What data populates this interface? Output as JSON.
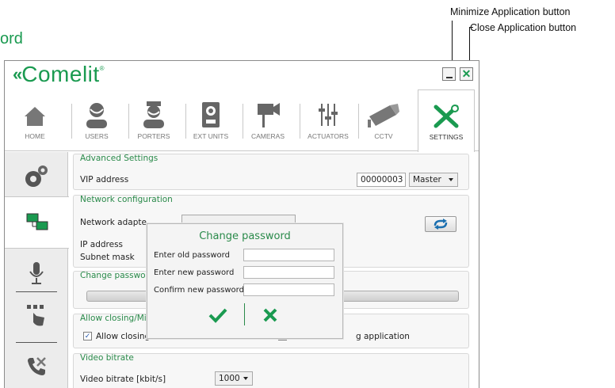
{
  "section_heading": "ord",
  "callouts": {
    "minimize": "Minimize Application button",
    "close": "Close Application button"
  },
  "app": {
    "brand": "Comelit",
    "brand_color": "#1a9a50"
  },
  "tabs": [
    {
      "label": "HOME",
      "icon": "home-icon"
    },
    {
      "label": "USERS",
      "icon": "users-icon"
    },
    {
      "label": "PORTERS",
      "icon": "porters-icon"
    },
    {
      "label": "EXT UNITS",
      "icon": "ext-units-icon"
    },
    {
      "label": "CAMERAS",
      "icon": "cameras-icon"
    },
    {
      "label": "ACTUATORS",
      "icon": "actuators-icon"
    },
    {
      "label": "CCTV",
      "icon": "cctv-icon"
    },
    {
      "label": "SETTINGS",
      "icon": "settings-tools-icon",
      "active": true
    }
  ],
  "sidebar": [
    {
      "icon": "gears-icon"
    },
    {
      "icon": "network-icon",
      "active": true
    },
    {
      "icon": "microphone-icon"
    },
    {
      "icon": "touch-icon"
    },
    {
      "icon": "phone-tools-icon"
    }
  ],
  "advanced": {
    "title": "Advanced Settings",
    "vip_label": "VIP address",
    "vip_value": "00000003",
    "role_value": "Master"
  },
  "network": {
    "title": "Network configuration",
    "adapter_label": "Network adapte",
    "ip_label": "IP address",
    "subnet_label": "Subnet mask"
  },
  "change_password_group": {
    "title": "Change passwo"
  },
  "allow_closing": {
    "title": "Allow closing/Mi",
    "checkbox_label": "Allow closing",
    "checkbox2_label": "g application",
    "checked": true
  },
  "video": {
    "title": "Video bitrate",
    "bitrate_label": "Video bitrate [kbit/s]",
    "bitrate_value": "1000"
  },
  "modal": {
    "title": "Change password",
    "old_label": "Enter old password",
    "new_label": "Enter new password",
    "confirm_label": "Confirm new password",
    "old_value": "",
    "new_value": "",
    "confirm_value": "",
    "ok_icon": "checkmark-icon",
    "cancel_icon": "cross-icon"
  }
}
